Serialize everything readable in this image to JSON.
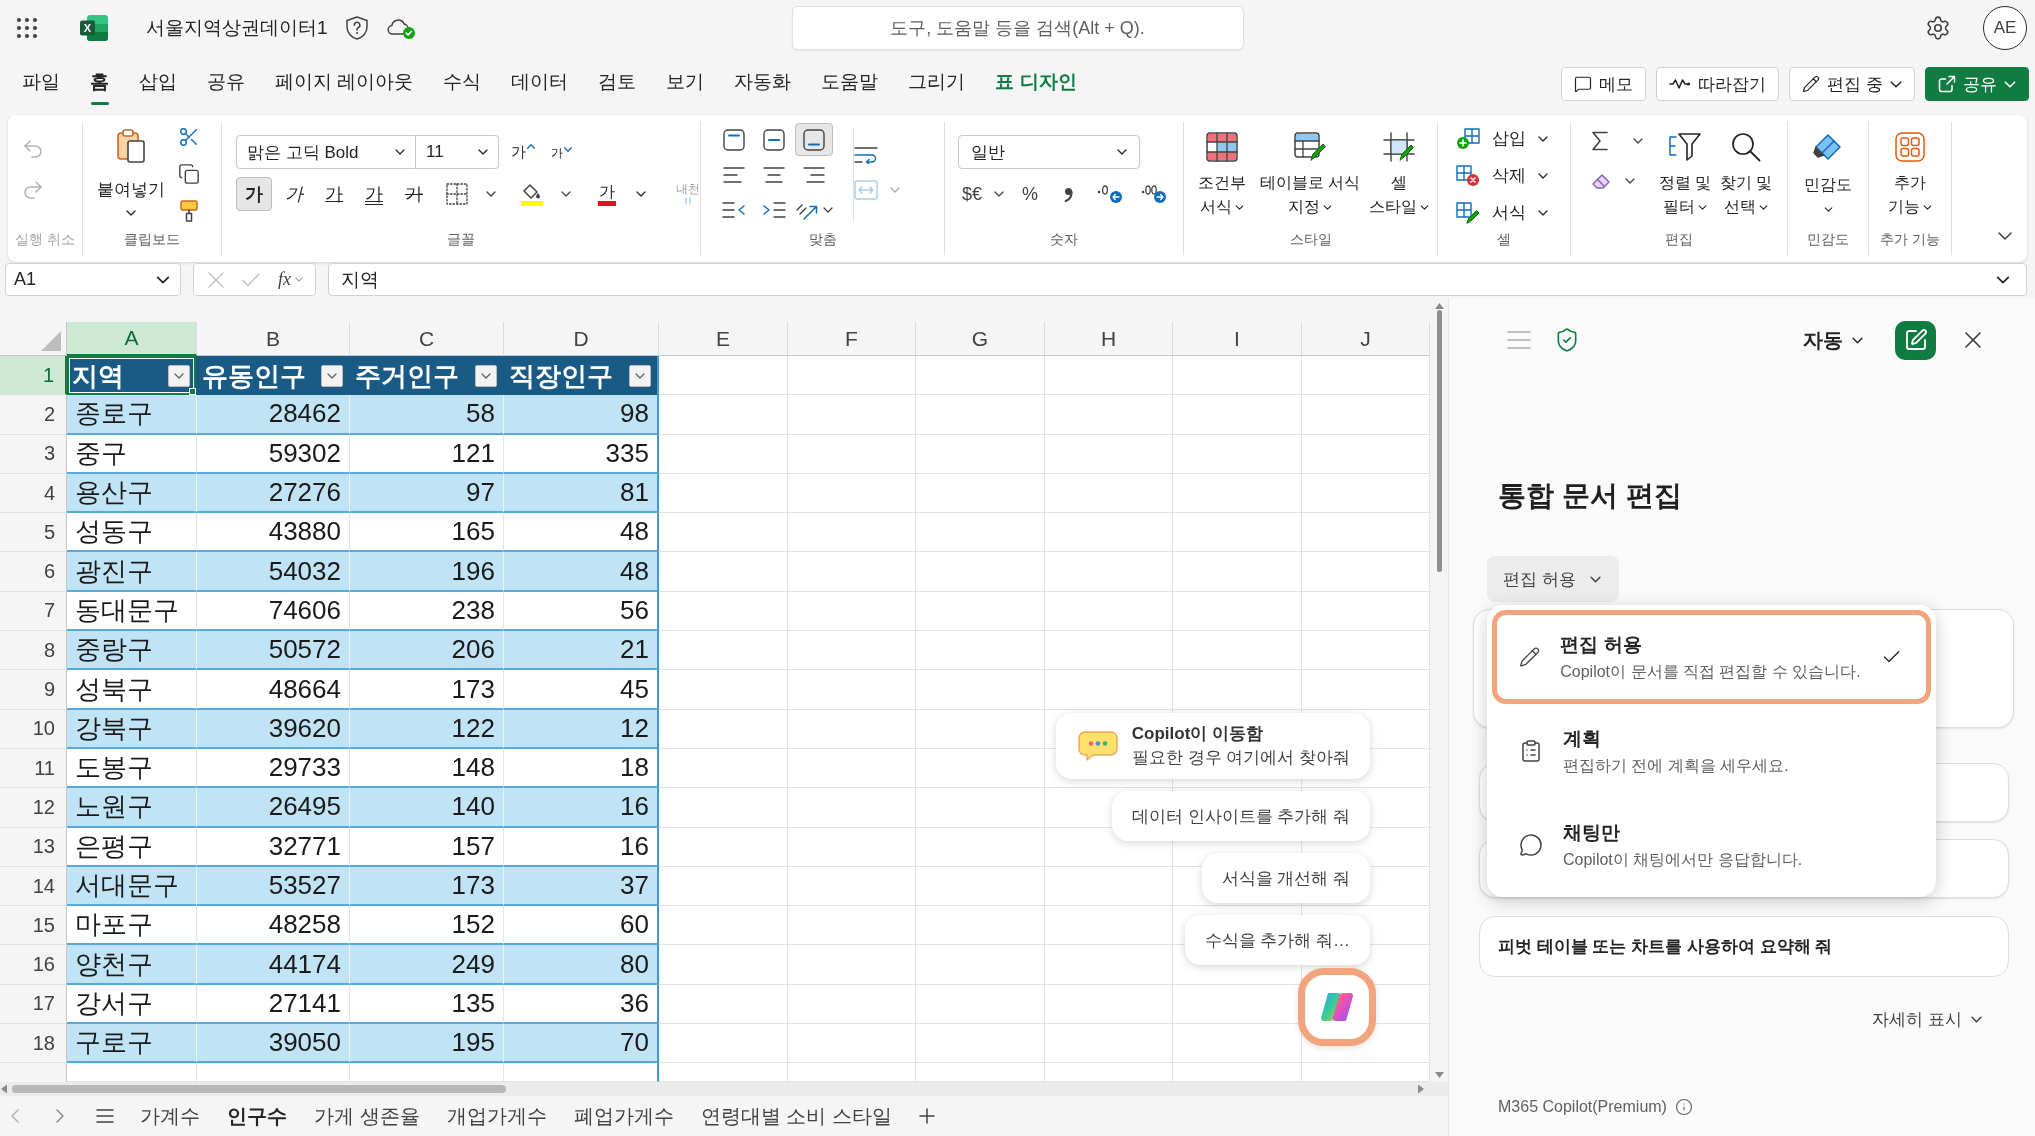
{
  "window": {
    "logo_letter": "X",
    "title": "서울지역상권데이터1",
    "search_placeholder": "도구, 도움말 등을 검색(Alt + Q).",
    "avatar": "AE"
  },
  "menu_tabs": [
    {
      "label": "파일",
      "kind": "standard",
      "selected": false
    },
    {
      "label": "홈",
      "kind": "standard",
      "selected": true
    },
    {
      "label": "삽입",
      "kind": "standard",
      "selected": false
    },
    {
      "label": "공유",
      "kind": "standard",
      "selected": false
    },
    {
      "label": "페이지 레이아웃",
      "kind": "standard",
      "selected": false
    },
    {
      "label": "수식",
      "kind": "standard",
      "selected": false
    },
    {
      "label": "데이터",
      "kind": "standard",
      "selected": false
    },
    {
      "label": "검토",
      "kind": "standard",
      "selected": false
    },
    {
      "label": "보기",
      "kind": "standard",
      "selected": false
    },
    {
      "label": "자동화",
      "kind": "standard",
      "selected": false
    },
    {
      "label": "도움말",
      "kind": "standard",
      "selected": false
    },
    {
      "label": "그리기",
      "kind": "standard",
      "selected": false
    },
    {
      "label": "표 디자인",
      "kind": "contextual",
      "selected": false
    }
  ],
  "header_buttons": [
    {
      "label": "메모",
      "kind": "comments"
    },
    {
      "label": "따라잡기",
      "kind": "catch_up"
    },
    {
      "label": "편집 중",
      "kind": "editing"
    },
    {
      "label": "공유",
      "kind": "share"
    }
  ],
  "ribbon": {
    "undo": {
      "label": "실행 취소",
      "disabled": true
    },
    "clipboard": {
      "label": "클립보드",
      "paste": "붙여넣기"
    },
    "font": {
      "label": "글꼴",
      "font_name": "맑은 고딕 Bold",
      "font_size": "11",
      "grow_glyph": "가",
      "shrink_glyph": "가",
      "buttons": [
        {
          "kind": "bold",
          "glyph": "가",
          "selected": true
        },
        {
          "kind": "italic",
          "glyph": "가",
          "selected": false
        },
        {
          "kind": "underline",
          "glyph": "가",
          "selected": false
        },
        {
          "kind": "double_underline",
          "glyph": "가",
          "selected": false
        },
        {
          "kind": "strikethrough",
          "glyph": "가",
          "selected": false
        }
      ],
      "font_color_glyph": "가",
      "asian_layout": {
        "glyph": "내천",
        "disabled": true
      }
    },
    "alignment": {
      "label": "맞춤",
      "vertical": [
        {
          "kind": "top",
          "selected": false
        },
        {
          "kind": "middle",
          "selected": false
        },
        {
          "kind": "bottom",
          "selected": true
        }
      ],
      "merge_disabled": true
    },
    "number": {
      "label": "숫자",
      "format": "일반",
      "currency": "$€",
      "percent": "%"
    },
    "styles": {
      "label": "스타일",
      "buttons": [
        {
          "kind": "conditional",
          "lines": [
            "조건부",
            "서식"
          ]
        },
        {
          "kind": "table",
          "lines": [
            "테이블로 서식",
            "지정"
          ]
        },
        {
          "kind": "cell",
          "lines": [
            "셀",
            "스타일"
          ]
        }
      ]
    },
    "cells": {
      "label": "셀",
      "buttons": [
        {
          "kind": "insert",
          "label": "삽입"
        },
        {
          "kind": "delete",
          "label": "삭제"
        },
        {
          "kind": "format",
          "label": "서식"
        }
      ]
    },
    "editing": {
      "label": "편집",
      "sort_filter": [
        "정렬 및",
        "필터"
      ],
      "find_select": [
        "찾기 및",
        "선택"
      ]
    },
    "sensitivity": {
      "label": "민감도",
      "button": "민감도"
    },
    "addins": {
      "label": "추가 기능",
      "lines": [
        "추가",
        "기능"
      ]
    }
  },
  "formula_bar": {
    "name_box": "A1",
    "edit_buttons_disabled": true,
    "function_label": "fx",
    "formula": "지역"
  },
  "sheet": {
    "columns": [
      {
        "label": "A",
        "selected": true
      },
      {
        "label": "B",
        "selected": false
      },
      {
        "label": "C",
        "selected": false
      },
      {
        "label": "D",
        "selected": false
      },
      {
        "label": "E",
        "selected": false
      },
      {
        "label": "F",
        "selected": false
      },
      {
        "label": "G",
        "selected": false
      },
      {
        "label": "H",
        "selected": false
      },
      {
        "label": "I",
        "selected": false
      },
      {
        "label": "J",
        "selected": false
      }
    ],
    "header_row": {
      "number": "1",
      "selected": true,
      "cells": [
        "지역",
        "유동인구",
        "주거인구",
        "직장인구"
      ]
    },
    "rows": [
      {
        "number": "2",
        "selected": false,
        "cells": [
          "종로구",
          "28462",
          "58",
          "98"
        ]
      },
      {
        "number": "3",
        "selected": false,
        "cells": [
          "중구",
          "59302",
          "121",
          "335"
        ]
      },
      {
        "number": "4",
        "selected": false,
        "cells": [
          "용산구",
          "27276",
          "97",
          "81"
        ]
      },
      {
        "number": "5",
        "selected": false,
        "cells": [
          "성동구",
          "43880",
          "165",
          "48"
        ]
      },
      {
        "number": "6",
        "selected": false,
        "cells": [
          "광진구",
          "54032",
          "196",
          "48"
        ]
      },
      {
        "number": "7",
        "selected": false,
        "cells": [
          "동대문구",
          "74606",
          "238",
          "56"
        ]
      },
      {
        "number": "8",
        "selected": false,
        "cells": [
          "중랑구",
          "50572",
          "206",
          "21"
        ]
      },
      {
        "number": "9",
        "selected": false,
        "cells": [
          "성북구",
          "48664",
          "173",
          "45"
        ]
      },
      {
        "number": "10",
        "selected": false,
        "cells": [
          "강북구",
          "39620",
          "122",
          "12"
        ]
      },
      {
        "number": "11",
        "selected": false,
        "cells": [
          "도봉구",
          "29733",
          "148",
          "18"
        ]
      },
      {
        "number": "12",
        "selected": false,
        "cells": [
          "노원구",
          "26495",
          "140",
          "16"
        ]
      },
      {
        "number": "13",
        "selected": false,
        "cells": [
          "은평구",
          "32771",
          "157",
          "16"
        ]
      },
      {
        "number": "14",
        "selected": false,
        "cells": [
          "서대문구",
          "53527",
          "173",
          "37"
        ]
      },
      {
        "number": "15",
        "selected": false,
        "cells": [
          "마포구",
          "48258",
          "152",
          "60"
        ]
      },
      {
        "number": "16",
        "selected": false,
        "cells": [
          "양천구",
          "44174",
          "249",
          "80"
        ]
      },
      {
        "number": "17",
        "selected": false,
        "cells": [
          "강서구",
          "27141",
          "135",
          "36"
        ]
      },
      {
        "number": "18",
        "selected": false,
        "cells": [
          "구로구",
          "39050",
          "195",
          "70"
        ]
      }
    ]
  },
  "copilot_hints": {
    "moved": {
      "title": "Copilot이 이동함",
      "text": "필요한 경우 여기에서 찾아줘"
    },
    "prompts": [
      "데이터 인사이트를 추가해 줘",
      "서식을 개선해 줘",
      "수식을 추가해 줘…"
    ]
  },
  "sheet_tabs": [
    {
      "label": "가계수",
      "selected": false
    },
    {
      "label": "인구수",
      "selected": true
    },
    {
      "label": "가게 생존율",
      "selected": false
    },
    {
      "label": "개업가게수",
      "selected": false
    },
    {
      "label": "폐업가게수",
      "selected": false
    },
    {
      "label": "연령대별 소비 스타일",
      "selected": false
    }
  ],
  "copilot_panel": {
    "mode": "자동",
    "title": "통합 문서 편집",
    "mode_dropdown": "편집 허용",
    "mode_menu": [
      {
        "kind": "edit",
        "title": "편집 허용",
        "description": "Copilot이 문서를 직접 편집할 수 있습니다.",
        "selected": true
      },
      {
        "kind": "plan",
        "title": "계획",
        "description": "편집하기 전에 계획을 세우세요.",
        "selected": false
      },
      {
        "kind": "chat",
        "title": "채팅만",
        "description": "Copilot이 채팅에서만 응답합니다.",
        "selected": false
      }
    ],
    "suggestions": [
      "피벗 테이블 또는 차트를 사용하여 요약해 줘"
    ],
    "show_more": "자세히 표시",
    "footer": "M365 Copilot(Premium)"
  }
}
